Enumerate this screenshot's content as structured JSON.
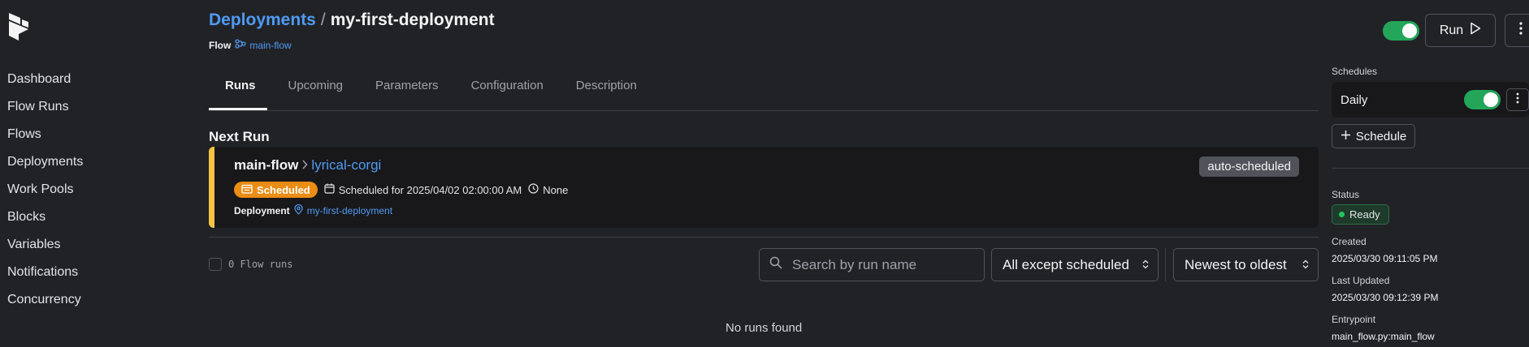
{
  "colors": {
    "background": "#212226",
    "card": "#18181b",
    "link": "#4f9bf3",
    "accent_green": "#23a65a",
    "scheduled_orange": "#eb8c14",
    "next_run_bar": "#f5c542"
  },
  "sidebar": {
    "logo_icon": "prefect-logo",
    "items": [
      {
        "label": "Dashboard"
      },
      {
        "label": "Flow Runs"
      },
      {
        "label": "Flows"
      },
      {
        "label": "Deployments"
      },
      {
        "label": "Work Pools"
      },
      {
        "label": "Blocks"
      },
      {
        "label": "Variables"
      },
      {
        "label": "Notifications"
      },
      {
        "label": "Concurrency"
      }
    ]
  },
  "header": {
    "breadcrumb_parent": "Deployments",
    "breadcrumb_separator": "/",
    "breadcrumb_current": "my-first-deployment",
    "flow_label": "Flow",
    "flow_name": "main-flow",
    "deployment_active": true,
    "run_label": "Run"
  },
  "tabs": [
    {
      "label": "Runs",
      "active": true
    },
    {
      "label": "Upcoming",
      "active": false
    },
    {
      "label": "Parameters",
      "active": false
    },
    {
      "label": "Configuration",
      "active": false
    },
    {
      "label": "Description",
      "active": false
    }
  ],
  "next_run": {
    "title": "Next Run",
    "flow_name": "main-flow",
    "run_name": "lyrical-corgi",
    "tag": "auto-scheduled",
    "state": "Scheduled",
    "scheduled_for": "Scheduled for 2025/04/02 02:00:00 AM",
    "duration": "None",
    "deployment_label": "Deployment",
    "deployment_name": "my-first-deployment"
  },
  "filters": {
    "count_text": "0 Flow runs",
    "search_placeholder": "Search by run name",
    "status_filter": "All except scheduled",
    "sort": "Newest to oldest"
  },
  "empty_state": "No runs found",
  "right_panel": {
    "schedules_label": "Schedules",
    "schedule_name": "Daily",
    "schedule_active": true,
    "add_schedule_label": "Schedule",
    "status_label": "Status",
    "status_value": "Ready",
    "created_label": "Created",
    "created_value": "2025/03/30 09:11:05 PM",
    "updated_label": "Last Updated",
    "updated_value": "2025/03/30 09:12:39 PM",
    "entrypoint_label": "Entrypoint",
    "entrypoint_value": "main_flow.py:main_flow"
  }
}
